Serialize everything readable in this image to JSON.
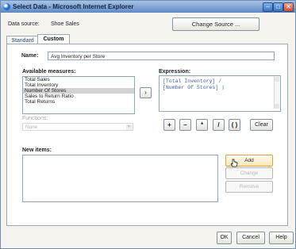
{
  "window": {
    "title": "Select Data - Microsoft Internet Explorer",
    "minimize": "–",
    "maximize": "□",
    "close": "✕"
  },
  "data_source": {
    "label": "Data source:",
    "value": "Shoe Sales",
    "change_button": "Change Source ..."
  },
  "tabs": [
    {
      "label": "Standard"
    },
    {
      "label": "Custom",
      "active": true
    }
  ],
  "name": {
    "label": "Name:",
    "value": "Avg Inventory per Store"
  },
  "available_measures": {
    "label": "Available measures:",
    "items": [
      "Total Sales",
      "Total Inventory",
      "Number Of Stores",
      "Sales to Return Ratio",
      "Total Returns"
    ],
    "selected_index": 2
  },
  "arrow_button": "›",
  "expression": {
    "label": "Expression:",
    "lines": [
      "[Total Inventory] /",
      "[Number Of Stores] |"
    ]
  },
  "functions": {
    "label": "Functions:",
    "value": "None"
  },
  "operators": [
    "+",
    "–",
    "*",
    "/",
    "( )"
  ],
  "clear_button": "Clear",
  "new_items": {
    "label": "New items:"
  },
  "side_buttons": {
    "add": "Add",
    "change": "Change",
    "remove": "Remove"
  },
  "footer": {
    "ok": "OK",
    "cancel": "Cancel",
    "help": "Help"
  },
  "colors": {
    "title_bar": "#5f89c4",
    "add_button": "#fce6b7",
    "selected_row": "#d3d3d3"
  }
}
